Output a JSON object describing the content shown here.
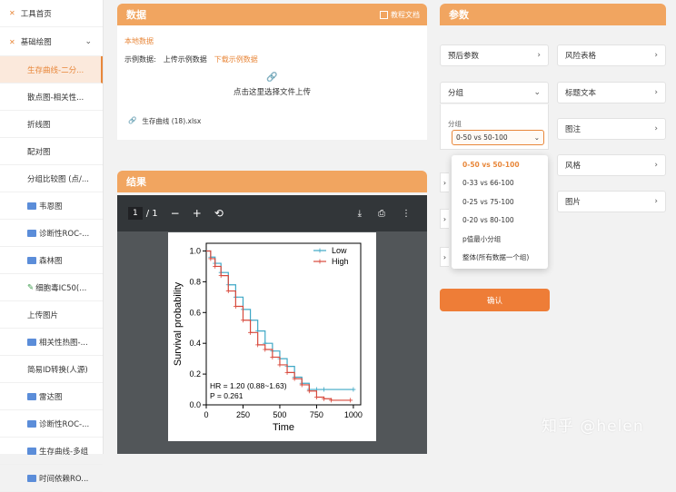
{
  "sidebar": {
    "home": "工具首页",
    "group": "基础绘图",
    "items": [
      {
        "label": "生存曲线-二分...",
        "icon": "",
        "active": true
      },
      {
        "label": "散点图-相关性...",
        "icon": ""
      },
      {
        "label": "折线图",
        "icon": ""
      },
      {
        "label": "配对图",
        "icon": ""
      },
      {
        "label": "分组比较图 (点/...",
        "icon": ""
      },
      {
        "label": "韦恩图",
        "icon": "new-badge"
      },
      {
        "label": "诊断性ROC-...",
        "icon": "new-badge"
      },
      {
        "label": "森林图",
        "icon": "new-badge"
      },
      {
        "label": "细胞毒IC50(...",
        "icon": "pen-icon"
      },
      {
        "label": "上传图片",
        "icon": ""
      },
      {
        "label": "相关性热图-...",
        "icon": "new-badge"
      },
      {
        "label": "简易ID转换(人源)",
        "icon": ""
      },
      {
        "label": "雷达图",
        "icon": "new-badge"
      },
      {
        "label": "诊断性ROC-...",
        "icon": "new-badge"
      },
      {
        "label": "生存曲线-多组",
        "icon": "new-badge"
      },
      {
        "label": "时间依赖RO...",
        "icon": "new-badge"
      }
    ]
  },
  "data_panel": {
    "title": "数据",
    "doc_link": "教程文档",
    "local_data": "本地数据",
    "example_label": "示例数据:",
    "upload_example": "上传示例数据",
    "download_example": "下载示例数据",
    "upload_text": "点击这里选择文件上传",
    "file_name": "生存曲线 (18).xlsx"
  },
  "result_panel": {
    "title": "结果",
    "page_current": "1",
    "page_total": "1"
  },
  "params_panel": {
    "title": "参数",
    "left_items": [
      "预后参数",
      "分组"
    ],
    "right_items": [
      "风险表格",
      "标题文本",
      "图注",
      "风格",
      "图片"
    ],
    "group_label": "分组",
    "group_value": "0-50 vs 50-100",
    "dropdown_options": [
      "0-50 vs 50-100",
      "0-33 vs 66-100",
      "0-25 vs 75-100",
      "0-20 vs 80-100",
      "p值最小分组",
      "整体(所有数据一个组)"
    ],
    "confirm": "确认"
  },
  "chart_data": {
    "type": "line",
    "xlabel": "Time",
    "ylabel": "Survival probability",
    "xlim": [
      0,
      1050
    ],
    "ylim": [
      0,
      1.05
    ],
    "xticks": [
      0,
      250,
      500,
      750,
      1000
    ],
    "yticks": [
      0.0,
      0.2,
      0.4,
      0.6,
      0.8,
      1.0
    ],
    "legend_position": "top-right",
    "annotation": [
      "HR = 1.20 (0.88~1.63)",
      "P = 0.261"
    ],
    "series": [
      {
        "name": "Low",
        "color": "#3fa8c6",
        "x": [
          0,
          30,
          60,
          100,
          150,
          200,
          250,
          300,
          350,
          400,
          450,
          500,
          550,
          600,
          650,
          700,
          750,
          800,
          1000
        ],
        "y": [
          1.0,
          0.96,
          0.92,
          0.86,
          0.78,
          0.7,
          0.62,
          0.55,
          0.48,
          0.4,
          0.35,
          0.3,
          0.25,
          0.18,
          0.14,
          0.1,
          0.1,
          0.1,
          0.1
        ]
      },
      {
        "name": "High",
        "color": "#d8493c",
        "x": [
          0,
          30,
          60,
          100,
          150,
          200,
          250,
          300,
          350,
          400,
          450,
          500,
          550,
          600,
          650,
          700,
          750,
          800,
          850,
          980
        ],
        "y": [
          1.0,
          0.95,
          0.9,
          0.84,
          0.74,
          0.64,
          0.55,
          0.47,
          0.39,
          0.36,
          0.31,
          0.26,
          0.21,
          0.17,
          0.13,
          0.09,
          0.05,
          0.04,
          0.03,
          0.03
        ]
      }
    ]
  },
  "watermark": "知乎 @helen"
}
